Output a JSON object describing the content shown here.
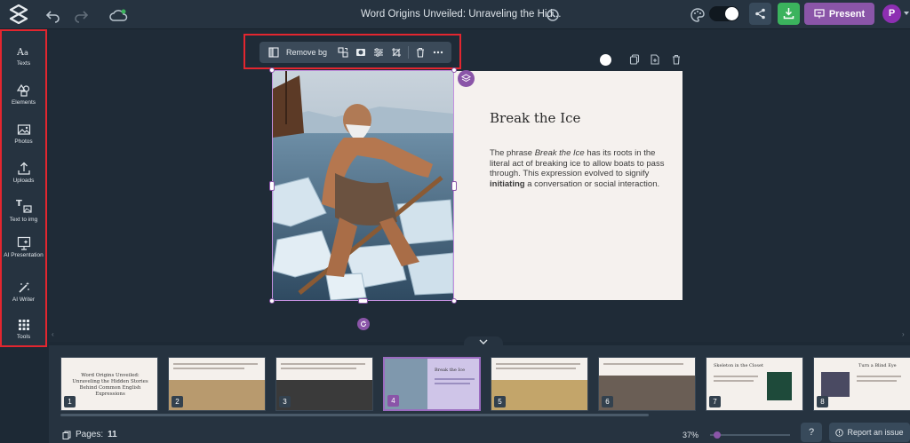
{
  "header": {
    "title": "Word Origins Unveiled: Unraveling the Hid...",
    "present_label": "Present",
    "avatar_initial": "P"
  },
  "sidebar": {
    "items": [
      {
        "label": "Texts",
        "icon": "text-aa-icon"
      },
      {
        "label": "Elements",
        "icon": "shapes-icon"
      },
      {
        "label": "Photos",
        "icon": "image-icon"
      },
      {
        "label": "Uploads",
        "icon": "upload-icon"
      },
      {
        "label": "Text to img",
        "icon": "text-to-image-icon"
      },
      {
        "label": "AI Presentation",
        "icon": "ai-presentation-icon"
      },
      {
        "label": "AI Writer",
        "icon": "magic-pen-icon"
      },
      {
        "label": "Tools",
        "icon": "grid-icon"
      }
    ]
  },
  "image_toolbar": {
    "remove_bg_label": "Remove bg"
  },
  "slide": {
    "heading": "Break the Ice",
    "body_pre": "The phrase ",
    "body_italic": "Break the Ice",
    "body_mid": " has its roots in the literal act of breaking ice to allow boats to pass through. This expression evolved to signify ",
    "body_bold": "initiating",
    "body_post": " a conversation or social interaction."
  },
  "filmstrip": {
    "thumbnails": [
      {
        "number": "1",
        "title": "Word Origins Unveiled: Unraveling the Hidden Stories Behind Common English Expressions"
      },
      {
        "number": "2",
        "title": ""
      },
      {
        "number": "3",
        "title": ""
      },
      {
        "number": "4",
        "title": "Break the Ice"
      },
      {
        "number": "5",
        "title": ""
      },
      {
        "number": "6",
        "title": ""
      },
      {
        "number": "7",
        "title": "Skeleton in the Closet"
      },
      {
        "number": "8",
        "title": "Turn a Blind Eye"
      }
    ]
  },
  "footer": {
    "pages_label": "Pages:",
    "pages_count": "11",
    "zoom": "37%",
    "help_label": "?",
    "report_label": "Report an issue"
  },
  "colors": {
    "accent": "#8a55a8",
    "download": "#3bb35d",
    "highlight_outline": "#e3262f"
  }
}
